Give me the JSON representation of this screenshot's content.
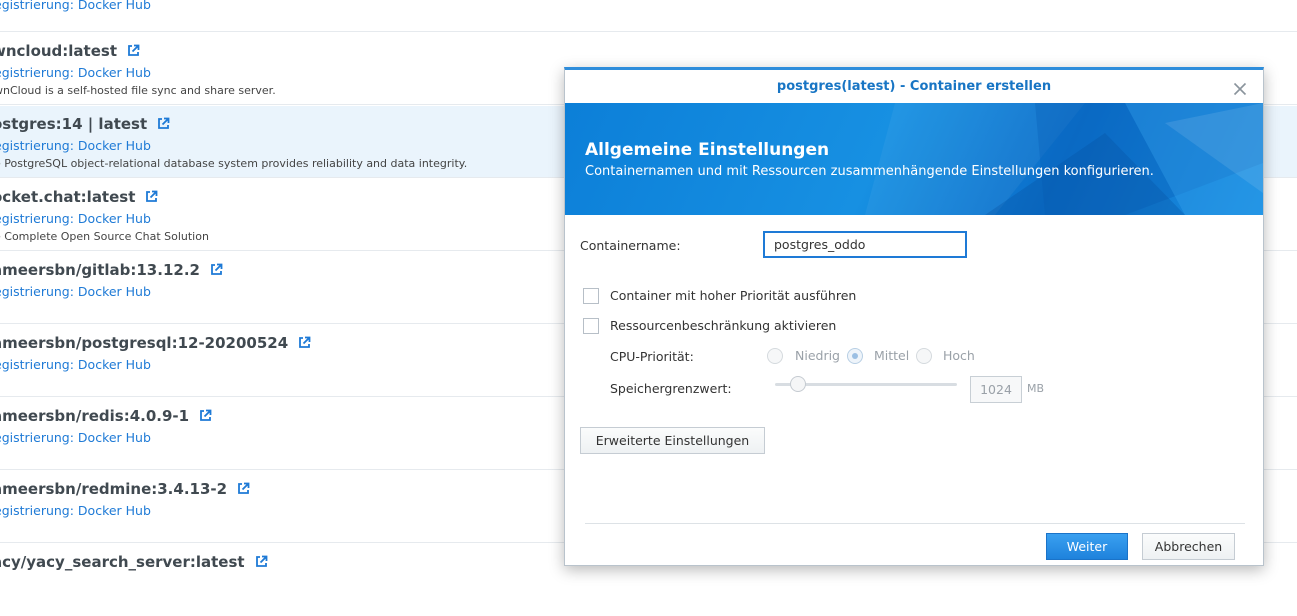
{
  "list": {
    "rows": [
      {
        "name": "",
        "registry": "egistrierung: Docker Hub",
        "desc": ""
      },
      {
        "name": "wncloud:latest",
        "registry": "egistrierung: Docker Hub",
        "desc": "wnCloud is a self-hosted file sync and share server."
      },
      {
        "name": "ostgres:14 | latest",
        "registry": "egistrierung: Docker Hub",
        "desc": "e PostgreSQL object-relational database system provides reliability and data integrity."
      },
      {
        "name": "ocket.chat:latest",
        "registry": "egistrierung: Docker Hub",
        "desc": "e Complete Open Source Chat Solution"
      },
      {
        "name": "ameersbn/gitlab:13.12.2",
        "registry": "egistrierung: Docker Hub",
        "desc": ""
      },
      {
        "name": "ameersbn/postgresql:12-20200524",
        "registry": "egistrierung: Docker Hub",
        "desc": ""
      },
      {
        "name": "ameersbn/redis:4.0.9-1",
        "registry": "egistrierung: Docker Hub",
        "desc": ""
      },
      {
        "name": "ameersbn/redmine:3.4.13-2",
        "registry": "egistrierung: Docker Hub",
        "desc": ""
      },
      {
        "name": "acy/yacy_search_server:latest",
        "registry": "",
        "desc": ""
      }
    ],
    "selected_index": 2,
    "link_icon": "external-link-icon",
    "accent_color": "#1e7ad6"
  },
  "modal": {
    "title": "postgres(latest) - Container erstellen",
    "close_icon": "close-icon",
    "banner": {
      "title": "Allgemeine Einstellungen",
      "subtitle": "Containernamen und mit Ressourcen zusammenhängende Einstellungen konfigurieren."
    },
    "container_name_label": "Containername:",
    "container_name_value": "postgres_oddo",
    "high_priority_label": "Container mit hoher Priorität ausführen",
    "high_priority_checked": false,
    "resource_limit_label": "Ressourcenbeschränkung aktivieren",
    "resource_limit_checked": false,
    "cpu_priority_label": "CPU-Priorität:",
    "cpu_options": [
      "Niedrig",
      "Mittel",
      "Hoch"
    ],
    "cpu_selected": "Mittel",
    "memory_label": "Speichergrenzwert:",
    "memory_value": "1024",
    "memory_unit": "MB",
    "advanced_button": "Erweiterte Einstellungen",
    "next_button": "Weiter",
    "cancel_button": "Abbrechen"
  }
}
